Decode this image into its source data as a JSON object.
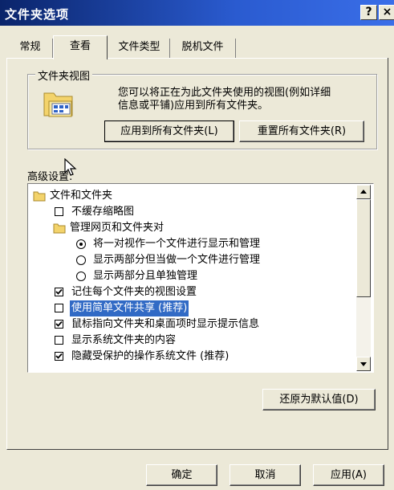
{
  "window": {
    "title": "文件夹选项",
    "help_label": "?",
    "close_label": "×"
  },
  "tabs": [
    {
      "label": "常规",
      "active": false
    },
    {
      "label": "查看",
      "active": true
    },
    {
      "label": "文件类型",
      "active": false
    },
    {
      "label": "脱机文件",
      "active": false
    }
  ],
  "folder_views": {
    "legend": "文件夹视图",
    "description_line1": "您可以将正在为此文件夹使用的视图(例如详细",
    "description_line2": "信息或平铺)应用到所有文件夹。",
    "apply_all_label": "应用到所有文件夹(L)",
    "reset_all_label": "重置所有文件夹(R)",
    "icon": "folder-view-icon"
  },
  "advanced": {
    "label": "高级设置:",
    "items": [
      {
        "kind": "folder",
        "label": "文件和文件夹",
        "level": 0
      },
      {
        "kind": "checkbox",
        "label": "不缓存缩略图",
        "level": 1,
        "checked": false
      },
      {
        "kind": "folder",
        "label": "管理网页和文件夹对",
        "level": 1
      },
      {
        "kind": "radio",
        "label": "将一对视作一个文件进行显示和管理",
        "level": 2,
        "checked": true
      },
      {
        "kind": "radio",
        "label": "显示两部分但当做一个文件进行管理",
        "level": 2,
        "checked": false
      },
      {
        "kind": "radio",
        "label": "显示两部分且单独管理",
        "level": 2,
        "checked": false
      },
      {
        "kind": "checkbox",
        "label": "记住每个文件夹的视图设置",
        "level": 1,
        "checked": true
      },
      {
        "kind": "checkbox",
        "label": "使用简单文件共享 (推荐)",
        "level": 1,
        "checked": false,
        "selected": true
      },
      {
        "kind": "checkbox",
        "label": "鼠标指向文件夹和桌面项时显示提示信息",
        "level": 1,
        "checked": true
      },
      {
        "kind": "checkbox",
        "label": "显示系统文件夹的内容",
        "level": 1,
        "checked": false
      },
      {
        "kind": "checkbox",
        "label": "隐藏受保护的操作系统文件 (推荐)",
        "level": 1,
        "checked": true
      }
    ],
    "restore_label": "还原为默认值(D)"
  },
  "footer": {
    "ok_label": "确定",
    "cancel_label": "取消",
    "apply_label": "应用(A)"
  },
  "colors": {
    "title_bar": "#0a246a",
    "selection": "#316ac5",
    "dialog_bg": "#ece9d8"
  }
}
